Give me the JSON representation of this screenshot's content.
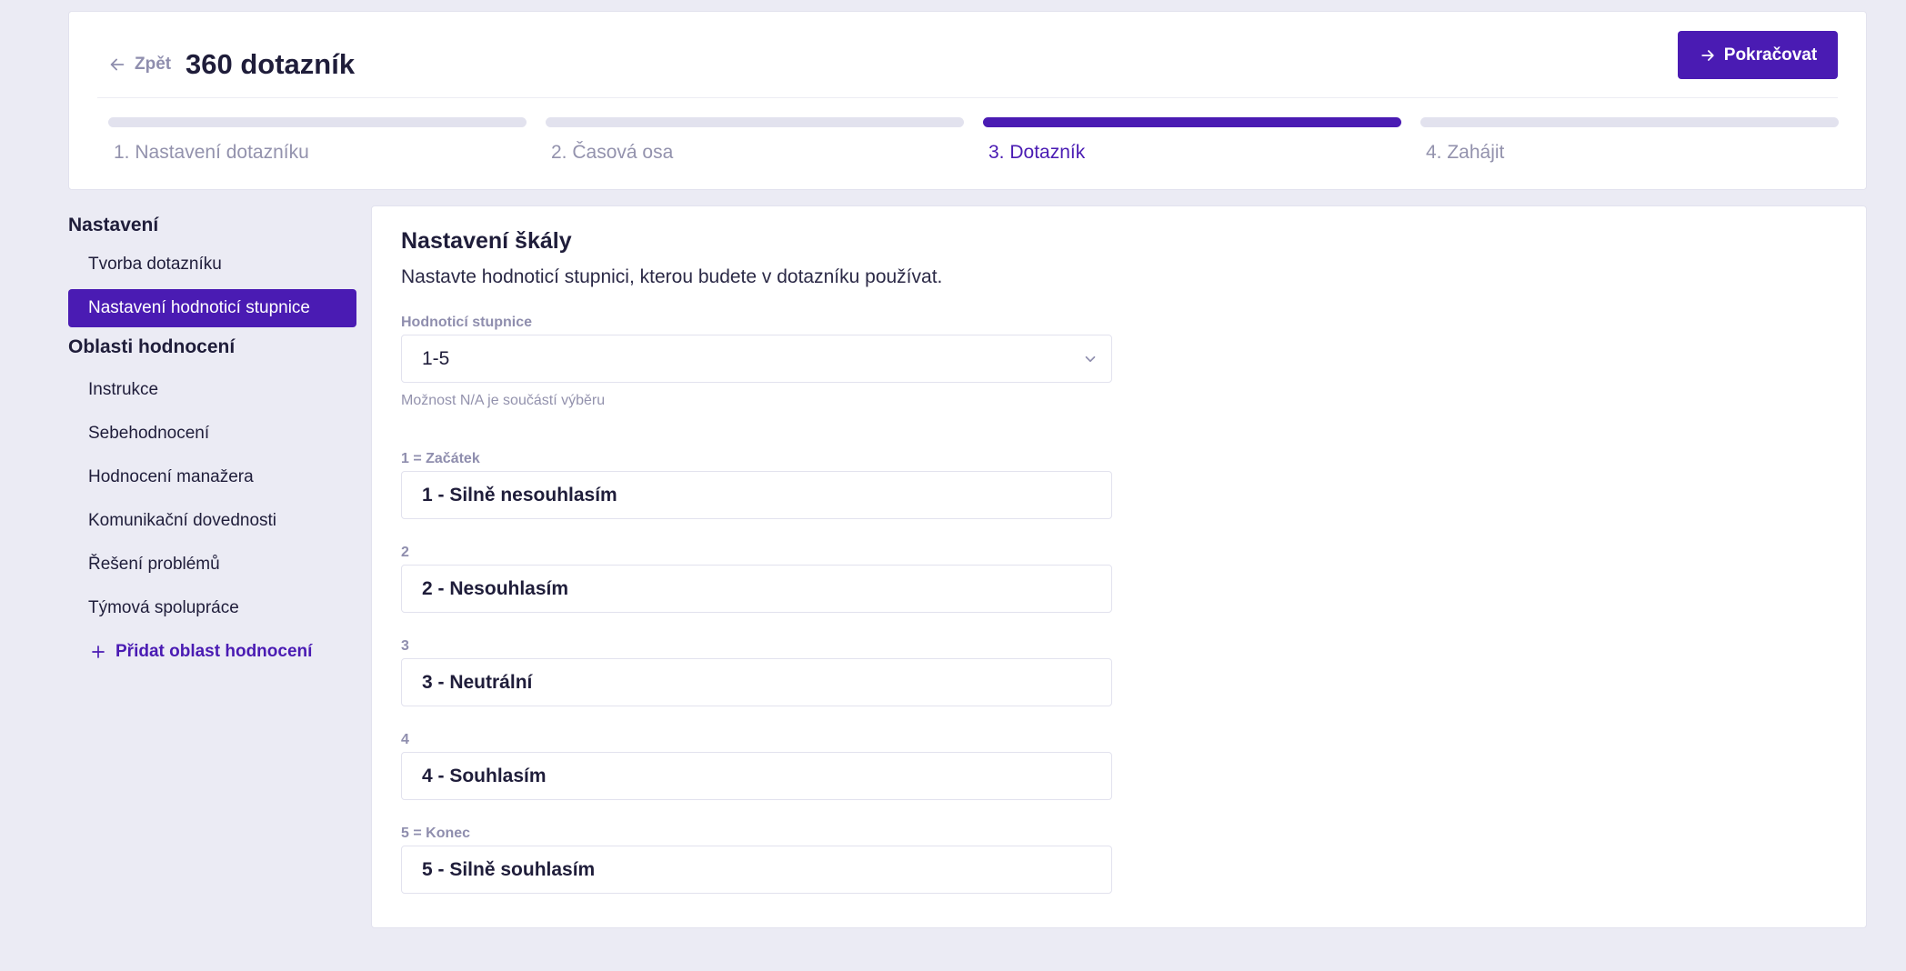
{
  "header": {
    "back_label": "Zpět",
    "title": "360 dotazník",
    "continue_label": "Pokračovat",
    "steps": [
      {
        "label": "1. Nastavení dotazníku",
        "active": false
      },
      {
        "label": "2. Časová osa",
        "active": false
      },
      {
        "label": "3. Dotazník",
        "active": true
      },
      {
        "label": "4. Zahájit",
        "active": false
      }
    ]
  },
  "sidebar": {
    "settings_heading": "Nastavení",
    "settings_items": [
      {
        "label": "Tvorba dotazníku",
        "active": false
      },
      {
        "label": "Nastavení hodnoticí stupnice",
        "active": true
      }
    ],
    "areas_heading": "Oblasti hodnocení",
    "area_items": [
      {
        "label": "Instrukce"
      },
      {
        "label": "Sebehodnocení"
      },
      {
        "label": "Hodnocení manažera"
      },
      {
        "label": "Komunikační dovednosti"
      },
      {
        "label": "Řešení problémů"
      },
      {
        "label": "Týmová spolupráce"
      }
    ],
    "add_area_label": "Přidat oblast hodnocení"
  },
  "main": {
    "title": "Nastavení škály",
    "description": "Nastavte hodnoticí stupnici, kterou budete v dotazníku používat.",
    "scale_label": "Hodnoticí stupnice",
    "scale_value": "1-5",
    "hint": "Možnost N/A je součástí výběru",
    "scale_fields": [
      {
        "label": "1 = Začátek",
        "value": "1 - Silně nesouhlasím"
      },
      {
        "label": "2",
        "value": "2 - Nesouhlasím"
      },
      {
        "label": "3",
        "value": "3 - Neutrální"
      },
      {
        "label": "4",
        "value": "4 - Souhlasím"
      },
      {
        "label": "5 = Konec",
        "value": "5 - Silně souhlasím"
      }
    ]
  },
  "colors": {
    "accent": "#4a1bb3",
    "background": "#ebebf4",
    "muted": "#8f8eae"
  }
}
